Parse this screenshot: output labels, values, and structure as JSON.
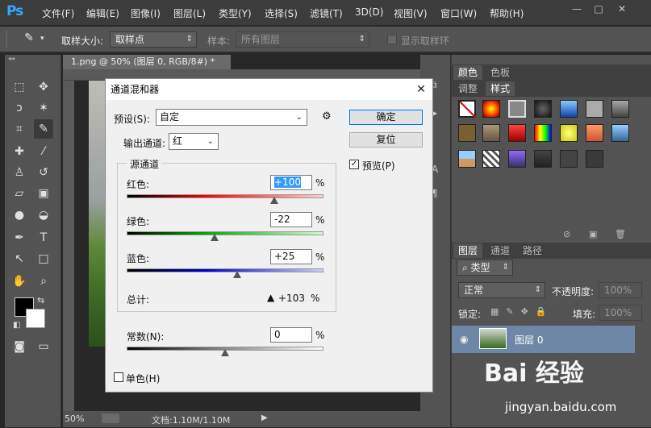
{
  "app": {
    "logo": "Ps"
  },
  "menu": [
    "文件(F)",
    "编辑(E)",
    "图像(I)",
    "图层(L)",
    "类型(Y)",
    "选择(S)",
    "滤镜(T)",
    "3D(D)",
    "视图(V)",
    "窗口(W)",
    "帮助(H)"
  ],
  "window_controls": {
    "minimize": "—",
    "restore": "□",
    "close": "✕"
  },
  "options": {
    "sample_size_label": "取样大小:",
    "sample_size_value": "取样点",
    "sample_label": "样本:",
    "sample_value": "所有图层",
    "show_ring_label": "显示取样环"
  },
  "document": {
    "tab_title": "1.png @ 50% (图层 0, RGB/8#) *",
    "tab_close": "×",
    "zoom": "50%",
    "doc_info": "文档:1.10M/1.10M"
  },
  "panels": {
    "tabs_top": [
      "颜色",
      "色板"
    ],
    "tabs_mid": [
      "调整",
      "样式"
    ],
    "tabs_layers": [
      "图层",
      "通道",
      "路径"
    ],
    "kind_filter": "类型",
    "blend_mode": "正常",
    "opacity_label": "不透明度:",
    "opacity_value": "100%",
    "lock_label": "锁定:",
    "fill_label": "填充:",
    "fill_value": "100%",
    "layer_name": "图层 0"
  },
  "dialog": {
    "title": "通道混和器",
    "preset_label": "预设(S):",
    "preset_value": "自定",
    "output_label": "输出通道:",
    "output_value": "红",
    "source_group": "源通道",
    "red_label": "红色:",
    "red_value": "+100",
    "green_label": "绿色:",
    "green_value": "-22",
    "blue_label": "蓝色:",
    "blue_value": "+25",
    "total_label": "总计:",
    "total_value": "+103",
    "percent": "%",
    "constant_label": "常数(N):",
    "constant_value": "0",
    "mono_label": "单色(H)",
    "ok_label": "确定",
    "reset_label": "复位",
    "preview_label": "预览(P)",
    "warning_icon": "warning-triangle-icon",
    "sliders": {
      "red": 100,
      "green": -22,
      "blue": 25,
      "constant": 0
    }
  },
  "watermark": {
    "brand": "Bai 经验",
    "url": "jingyan.baidu.com"
  },
  "colors": {
    "accent": "#31a8ff",
    "selection": "#3399ff",
    "layer_selected": "#6f87a6"
  }
}
